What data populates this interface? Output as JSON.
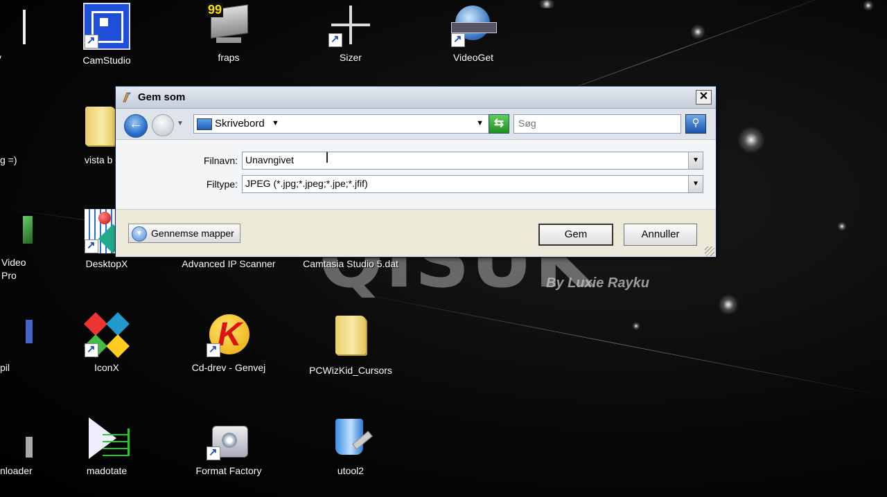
{
  "desktop": {
    "watermark": {
      "big": "QISUK",
      "small": "By Luxie Rayku"
    },
    "icons": [
      {
        "label": "tory"
      },
      {
        "label": "CamStudio"
      },
      {
        "label": "fraps",
        "badge": "99"
      },
      {
        "label": "Sizer"
      },
      {
        "label": "VideoGet"
      },
      {
        "label": "vista b"
      },
      {
        "label": "g =)"
      },
      {
        "label": "Video"
      },
      {
        "label": "Pro"
      },
      {
        "label": "DesktopX"
      },
      {
        "label": "Advanced IP Scanner"
      },
      {
        "label": "Camtasia Studio 5.dat"
      },
      {
        "label": "pil"
      },
      {
        "label": "IconX"
      },
      {
        "label": "Cd-drev - Genvej"
      },
      {
        "label": "PCWizKid_Cursors"
      },
      {
        "label": "nloader"
      },
      {
        "label": "madotate"
      },
      {
        "label": "Format Factory"
      },
      {
        "label": "utool2"
      }
    ]
  },
  "dialog": {
    "title": "Gem som",
    "close_glyph": "✕",
    "address": {
      "location": "Skrivebord"
    },
    "search": {
      "placeholder": "Søg"
    },
    "filename": {
      "label": "Filnavn:",
      "value": "Unavngivet"
    },
    "filetype": {
      "label": "Filtype:",
      "value": "JPEG (*.jpg;*.jpeg;*.jpe;*.jfif)"
    },
    "browse_label": "Gennemse mapper",
    "save_label": "Gem",
    "cancel_label": "Annuller"
  },
  "icons": {
    "back": "back-arrow-icon",
    "forward": "forward-arrow-icon",
    "refresh": "refresh-icon",
    "search": "magnifier-icon",
    "computer": "desktop-icon",
    "browse": "chevron-down-icon"
  }
}
